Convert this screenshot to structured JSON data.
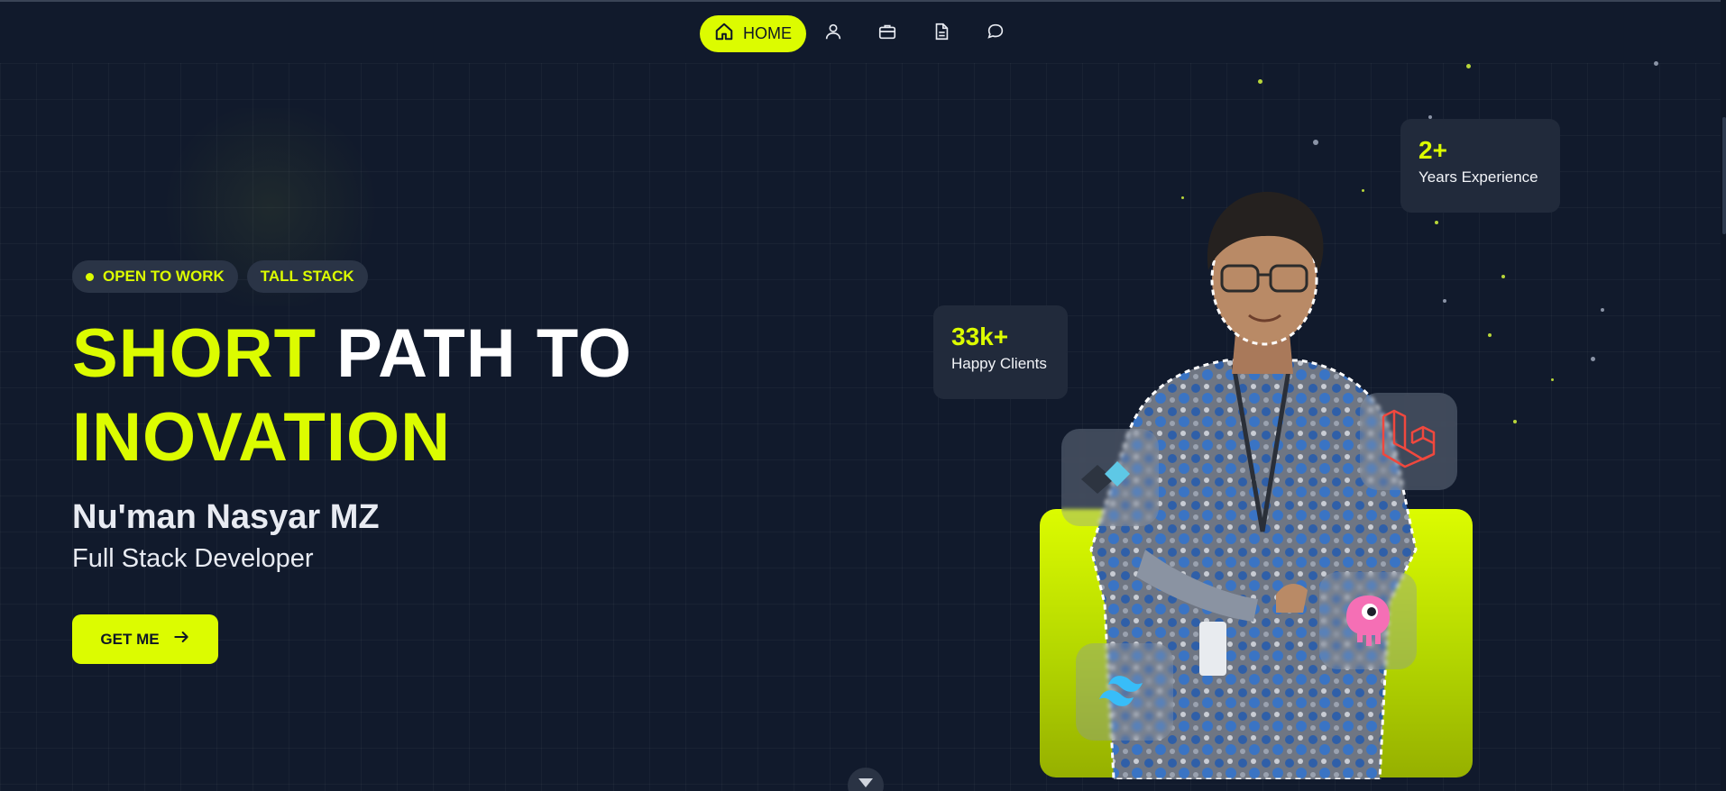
{
  "nav": {
    "home_label": "HOME",
    "items": [
      {
        "icon": "user-icon"
      },
      {
        "icon": "briefcase-icon"
      },
      {
        "icon": "document-icon"
      },
      {
        "icon": "chat-icon"
      }
    ]
  },
  "hero": {
    "badges": [
      "OPEN TO WORK",
      "TALL STACK"
    ],
    "headline": {
      "word1": "SHORT",
      "word2": "PATH TO",
      "word3": "INOVATION"
    },
    "name": "Nu'man Nasyar MZ",
    "role": "Full Stack Developer",
    "cta_label": "GET ME"
  },
  "stats": [
    {
      "value": "2+",
      "label": "Years Experience"
    },
    {
      "value": "33k+",
      "label": "Happy Clients"
    }
  ],
  "tech_icons": [
    "figma-icon",
    "laravel-icon",
    "livewire-icon",
    "tailwind-icon"
  ],
  "colors": {
    "accent": "#dcfc00",
    "background": "#111a2c",
    "card": "#212a3b"
  }
}
